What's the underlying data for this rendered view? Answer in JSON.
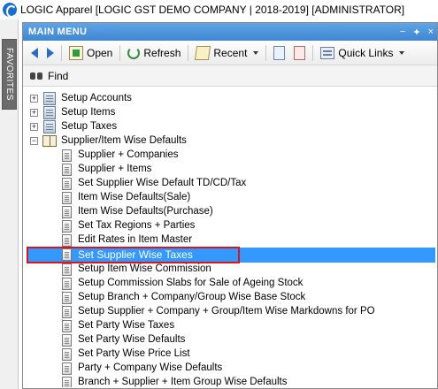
{
  "window": {
    "title": "LOGIC Apparel [LOGIC GST DEMO COMPANY | 2018-2019] [ADMINISTRATOR]"
  },
  "favorites": {
    "label": "FAVORITES"
  },
  "panel": {
    "title": "MAIN MENU",
    "pin_glyph": "−",
    "pin2_glyph": "✦",
    "close_glyph": "×"
  },
  "toolbar": {
    "open_label": "Open",
    "refresh_label": "Refresh",
    "recent_label": "Recent",
    "quick_links_label": "Quick Links"
  },
  "find": {
    "label": "Find"
  },
  "tree": {
    "root_items": [
      {
        "label": "Setup Accounts",
        "expander": "+"
      },
      {
        "label": "Setup Items",
        "expander": "+"
      },
      {
        "label": "Setup Taxes",
        "expander": "+"
      },
      {
        "label": "Supplier/Item Wise Defaults",
        "expander": "−"
      }
    ],
    "children": [
      "Supplier + Companies",
      "Supplier + Items",
      "Set Supplier Wise Default TD/CD/Tax",
      "Item Wise Defaults(Sale)",
      "Item Wise Defaults(Purchase)",
      "Set Tax Regions + Parties",
      "Edit Rates in Item Master",
      "Set Supplier Wise Taxes",
      "Setup Item Wise Commission",
      "Setup Commission Slabs for Sale of Ageing Stock",
      "Setup Branch + Company/Group Wise Base Stock",
      "Setup Supplier + Company + Group/Item Wise Markdowns for PO",
      "Set Party Wise Taxes",
      "Set Party Wise Defaults",
      "Set Party Wise Price List",
      "Party + Company Wise Defaults",
      "Branch + Supplier + Item Group Wise Defaults"
    ],
    "selected_label": "Set Supplier Wise Taxes"
  },
  "colors": {
    "header_blue": "#4a8fdb",
    "selection_blue": "#3399ff",
    "highlight_red": "#d9141b"
  }
}
